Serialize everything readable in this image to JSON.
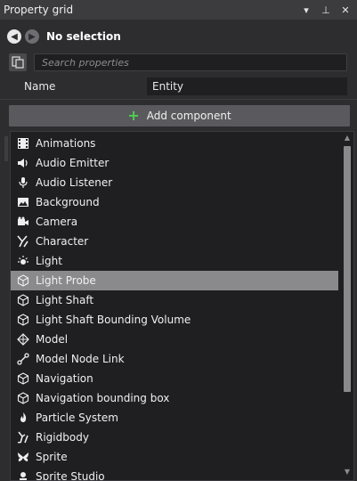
{
  "window": {
    "title": "Property grid",
    "controls": [
      "▾",
      "⊥",
      "✕"
    ]
  },
  "nav": {
    "back_icon": "arrow-left",
    "forward_icon": "arrow-right",
    "selection": "No selection"
  },
  "search": {
    "icon": "copy-settings-icon",
    "placeholder": "Search properties"
  },
  "properties": {
    "name_label": "Name",
    "name_value": "Entity"
  },
  "add_component": {
    "label": "Add component",
    "accent": "#4ed04e"
  },
  "component_list": {
    "selected_index": 7,
    "items": [
      {
        "label": "Animations",
        "icon": "film-icon"
      },
      {
        "label": "Audio Emitter",
        "icon": "speaker-icon"
      },
      {
        "label": "Audio Listener",
        "icon": "microphone-icon"
      },
      {
        "label": "Background",
        "icon": "image-icon"
      },
      {
        "label": "Camera",
        "icon": "camera-icon"
      },
      {
        "label": "Character",
        "icon": "character-icon"
      },
      {
        "label": "Light",
        "icon": "light-icon"
      },
      {
        "label": "Light Probe",
        "icon": "cube-icon"
      },
      {
        "label": "Light Shaft",
        "icon": "cube-icon"
      },
      {
        "label": "Light Shaft Bounding Volume",
        "icon": "cube-icon"
      },
      {
        "label": "Model",
        "icon": "model-icon"
      },
      {
        "label": "Model Node Link",
        "icon": "link-icon"
      },
      {
        "label": "Navigation",
        "icon": "cube-icon"
      },
      {
        "label": "Navigation bounding box",
        "icon": "cube-icon"
      },
      {
        "label": "Particle System",
        "icon": "fire-icon"
      },
      {
        "label": "Rigidbody",
        "icon": "rigidbody-icon"
      },
      {
        "label": "Sprite",
        "icon": "butterfly-icon"
      },
      {
        "label": "Sprite Studio",
        "icon": "sprite-studio-icon"
      }
    ]
  }
}
